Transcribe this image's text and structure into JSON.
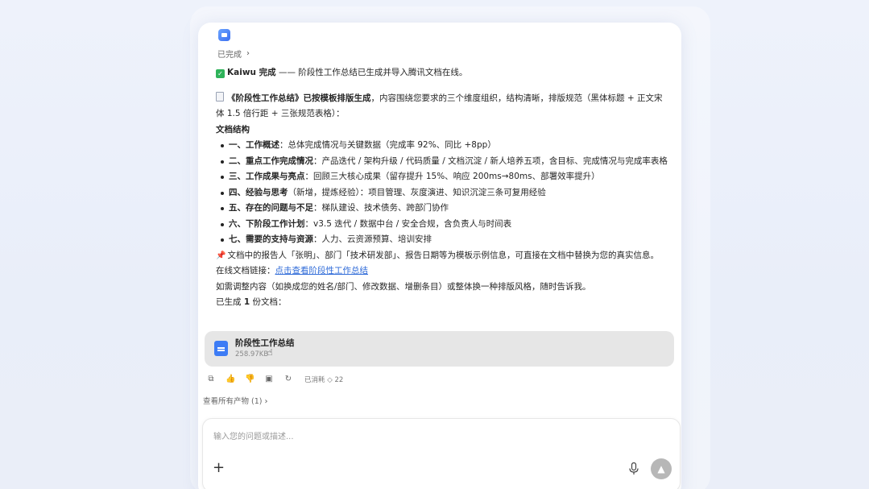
{
  "status": {
    "label": "已完成"
  },
  "message": {
    "headline_bold": "Kaiwu 完成",
    "headline_rest": " —— 阶段性工作总结已生成并导入腾讯文档在线。",
    "intro_bold": "《阶段性工作总结》已按模板排版生成",
    "intro_rest_1": "，内容围绕您要求的三个维度组织，结构清晰，排版规范（黑体标题 + 正文宋",
    "intro_rest_2": "体 1.5 倍行距 + 三张规范表格）：",
    "structure_heading": "文档结构",
    "outline": [
      {
        "title": "一、工作概述",
        "desc": "：总体完成情况与关键数据（完成率 92%、同比 +8pp）"
      },
      {
        "title": "二、重点工作完成情况",
        "desc": "：产品迭代 / 架构升级 / 代码质量 / 文档沉淀 / 新人培养五项，含目标、完成情况与完成率表格"
      },
      {
        "title": "三、工作成果与亮点",
        "desc": "：回顾三大核心成果（留存提升 15%、响应 200ms→80ms、部署效率提升）"
      },
      {
        "title": "四、经验与思考",
        "desc": "（新增，提炼经验）：项目管理、灰度演进、知识沉淀三条可复用经验"
      },
      {
        "title": "五、存在的问题与不足",
        "desc": "：梯队建设、技术债务、跨部门协作"
      },
      {
        "title": "六、下阶段工作计划",
        "desc": "：v3.5 迭代 / 数据中台 / 安全合规，含负责人与时间表"
      },
      {
        "title": "七、需要的支持与资源",
        "desc": "：人力、云资源预算、培训安排"
      }
    ],
    "note": "文档中的报告人「张明」、部门「技术研发部」、报告日期等为模板示例信息，可直接在文档中替换为您的真实信息。",
    "link_label": "在线文档链接：",
    "link_text": "点击查看阶段性工作总结",
    "adjust_hint": "如需调整内容（如换成您的姓名/部门、修改数据、增删条目）或整体换一种排版风格，随时告诉我。",
    "generated_prefix": "已生成 ",
    "generated_count": "1",
    "generated_suffix": " 份文档："
  },
  "document_card": {
    "name": "阶段性工作总结",
    "size": "258.97KB"
  },
  "actions": {
    "meta": "已消耗 ◇ 22"
  },
  "artifacts_label": "查看所有产物 (1)",
  "composer": {
    "placeholder": "输入您的问题或描述..."
  },
  "colors": {
    "accent": "#2f6bd8",
    "file_icon": "#3d7cf5",
    "check": "#2fb35a",
    "send_button": "#b7b7b7"
  }
}
